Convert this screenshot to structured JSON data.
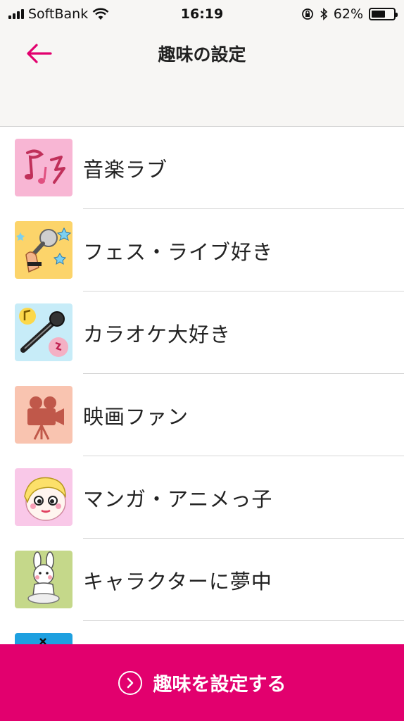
{
  "status_bar": {
    "carrier": "SoftBank",
    "time": "16:19",
    "battery_percent": "62%",
    "battery_level": 0.62,
    "icons": [
      "signal-icon",
      "wifi-icon",
      "orientation-lock-icon",
      "bluetooth-icon",
      "battery-icon"
    ]
  },
  "header": {
    "title": "趣味の設定",
    "back_icon": "back-arrow-icon"
  },
  "hobbies": [
    {
      "label": "音楽ラブ",
      "icon": "music-notes-icon"
    },
    {
      "label": "フェス・ライブ好き",
      "icon": "live-microphone-icon"
    },
    {
      "label": "カラオケ大好き",
      "icon": "karaoke-mic-icon"
    },
    {
      "label": "映画ファン",
      "icon": "movie-camera-icon"
    },
    {
      "label": "マンガ・アニメっ子",
      "icon": "manga-girl-icon"
    },
    {
      "label": "キャラクターに夢中",
      "icon": "character-bunny-icon"
    },
    {
      "label": "",
      "icon": "partial-icon"
    }
  ],
  "footer": {
    "button_label": "趣味を設定する",
    "button_icon": "chevron-right-circle-icon"
  },
  "colors": {
    "accent": "#e2006e",
    "header_bg": "#f7f6f4"
  }
}
